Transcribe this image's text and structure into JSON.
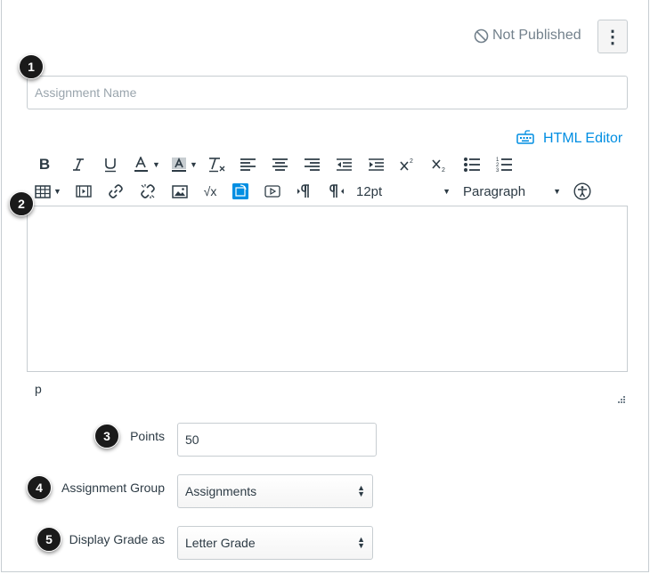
{
  "header": {
    "publish_status": "Not Published",
    "publish_icon": "not-published-icon",
    "options_icon": "kebab-menu-icon",
    "options_glyph": "⋮"
  },
  "callouts": [
    "1",
    "2",
    "3",
    "4",
    "5"
  ],
  "assignment_name": {
    "value": "",
    "placeholder": "Assignment Name"
  },
  "editor": {
    "html_editor_label": "HTML Editor",
    "html_editor_icon": "keyboard-icon",
    "toolbar_row1": [
      "bold-icon",
      "italic-icon",
      "underline-icon",
      "text-color-icon",
      "background-color-icon",
      "clear-formatting-icon",
      "align-left-icon",
      "align-center-icon",
      "align-right-icon",
      "outdent-icon",
      "indent-icon",
      "superscript-icon",
      "subscript-icon",
      "bulleted-list-icon",
      "numbered-list-icon"
    ],
    "toolbar_row2": [
      "table-icon",
      "media-icon",
      "link-icon",
      "unlink-icon",
      "image-icon",
      "equation-icon",
      "embed-image-icon",
      "video-icon",
      "ltr-paragraph-icon",
      "rtl-paragraph-icon",
      "accessibility-icon"
    ],
    "font_size": "12pt",
    "block_format": "Paragraph",
    "equation_glyph": "√x",
    "body_text": "",
    "path": "p"
  },
  "fields": {
    "points": {
      "label": "Points",
      "value": "50"
    },
    "assignment_group": {
      "label": "Assignment Group",
      "value": "Assignments"
    },
    "display_grade_as": {
      "label": "Display Grade as",
      "value": "Letter Grade"
    }
  },
  "colors": {
    "accent": "#008ee2",
    "text": "#2d3b45",
    "muted": "#73818c",
    "border": "#c7cdd1",
    "callout": "#1a1a1a"
  }
}
